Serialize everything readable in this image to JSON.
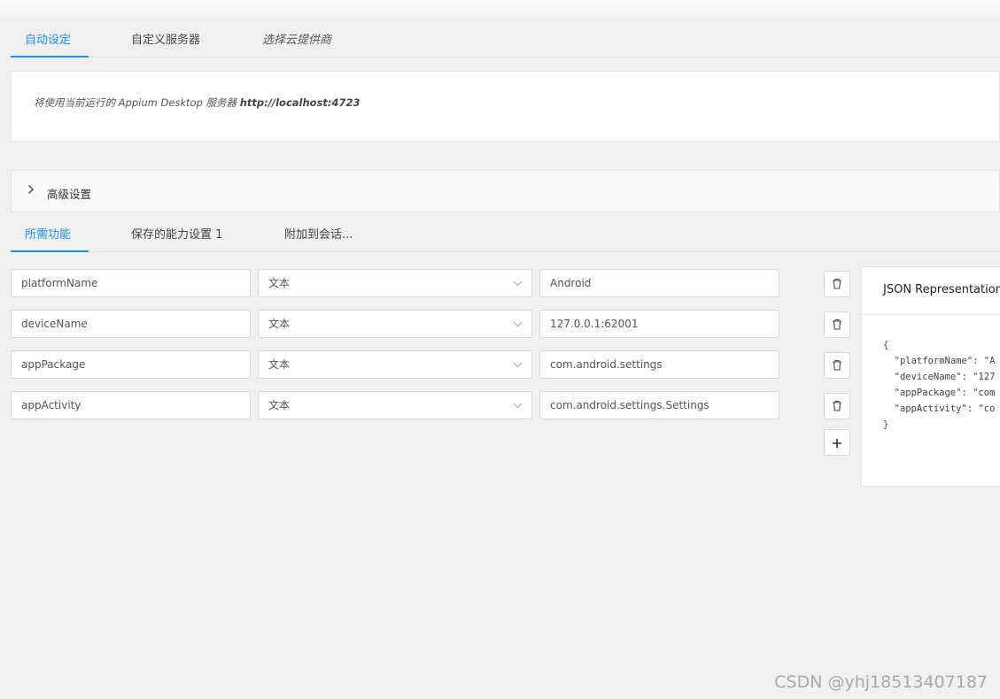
{
  "server_tabs": [
    {
      "label": "自动设定",
      "active": true
    },
    {
      "label": "自定义服务器",
      "active": false
    },
    {
      "label": "选择云提供商",
      "active": false
    }
  ],
  "server_note_prefix": "将使用当前运行的 Appium Desktop 服务器 ",
  "server_note_url": "http://localhost:4723",
  "advanced": {
    "label": "高级设置",
    "icon": "chevron-right-icon"
  },
  "cap_tabs": [
    {
      "label": "所需功能",
      "active": true
    },
    {
      "label": "保存的能力设置 1",
      "active": false
    },
    {
      "label": "附加到会话...",
      "active": false
    }
  ],
  "capabilities": [
    {
      "name": "platformName",
      "type": "文本",
      "value": "Android"
    },
    {
      "name": "deviceName",
      "type": "文本",
      "value": "127.0.0.1:62001"
    },
    {
      "name": "appPackage",
      "type": "文本",
      "value": "com.android.settings"
    },
    {
      "name": "appActivity",
      "type": "文本",
      "value": "com.android.settings.Settings"
    }
  ],
  "json_panel": {
    "title": "JSON Representation",
    "lines": [
      "{",
      "  \"platformName\": \"A",
      "  \"deviceName\": \"127",
      "  \"appPackage\": \"com",
      "  \"appActivity\": \"co",
      "}"
    ]
  },
  "watermark": "CSDN @yhj18513407187",
  "colors": {
    "accent": "#1890ff",
    "background": "#f0f0f0"
  }
}
